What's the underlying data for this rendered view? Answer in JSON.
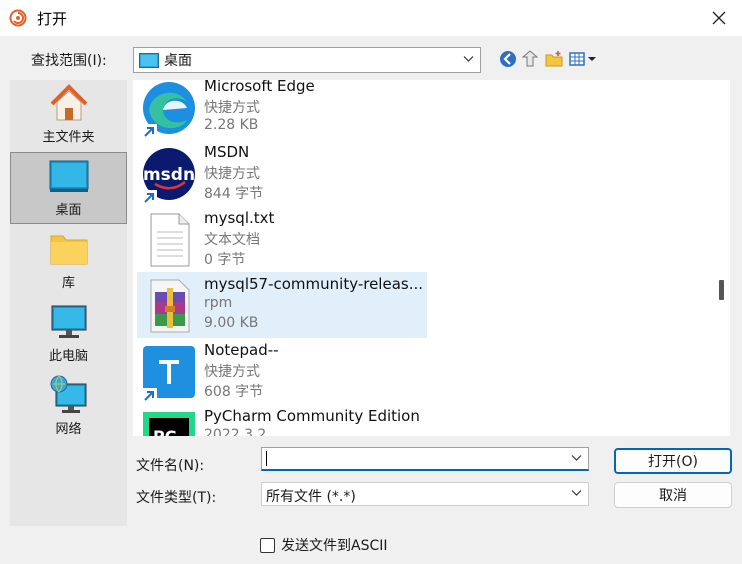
{
  "window": {
    "title": "打开"
  },
  "toolbar": {
    "lookin_label": "查找范围(I):",
    "lookin_value": "桌面",
    "icons": [
      "back-icon",
      "up-folder-icon",
      "new-folder-icon",
      "view-menu-icon"
    ]
  },
  "places": [
    {
      "label": "主文件夹",
      "icon": "home-icon"
    },
    {
      "label": "桌面",
      "icon": "desktop-icon",
      "selected": true
    },
    {
      "label": "库",
      "icon": "library-folder-icon"
    },
    {
      "label": "此电脑",
      "icon": "computer-icon"
    },
    {
      "label": "网络",
      "icon": "network-icon"
    }
  ],
  "files": [
    {
      "name": "Microsoft Edge",
      "type": "快捷方式",
      "size": "2.28 KB",
      "icon": "edge-icon",
      "shortcut": true
    },
    {
      "name": "MSDN",
      "type": "快捷方式",
      "size": "844 字节",
      "icon": "msdn-icon",
      "shortcut": true
    },
    {
      "name": "mysql.txt",
      "type": "文本文档",
      "size": "0 字节",
      "icon": "text-file-icon",
      "shortcut": false
    },
    {
      "name": "mysql57-community-releas...",
      "type": "rpm",
      "size": "9.00 KB",
      "icon": "archive-icon",
      "shortcut": false,
      "selected": true
    },
    {
      "name": "Notepad--",
      "type": "快捷方式",
      "size": "608 字节",
      "icon": "notepad-icon",
      "shortcut": true
    },
    {
      "name": "PyCharm Community Edition",
      "type": "2022.3.2",
      "size": "",
      "icon": "pycharm-icon",
      "shortcut": false
    }
  ],
  "filename": {
    "label": "文件名(N):",
    "value": ""
  },
  "filetype": {
    "label": "文件类型(T):",
    "value": "所有文件 (*.*)"
  },
  "buttons": {
    "open": "打开(O)",
    "cancel": "取消"
  },
  "ascii_checkbox": {
    "label": "发送文件到ASCII",
    "checked": false
  },
  "colors": {
    "accent": "#0067c0",
    "selection": "#e1effa"
  }
}
